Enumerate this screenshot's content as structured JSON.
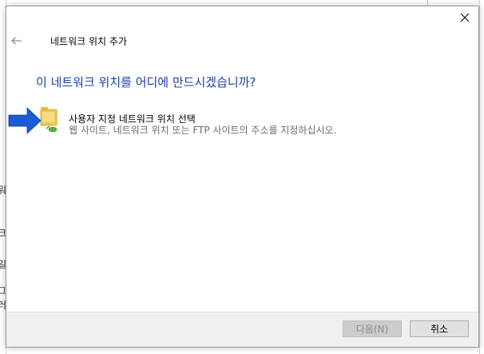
{
  "dialog": {
    "title": "네트워크 위치 추가",
    "heading": "이 네트워크 위치를 어디에 만드시겠습니까?",
    "option": {
      "title": "사용자 지정 네트워크 위치 선택",
      "description": "웹 사이트, 네트워크 위치 또는 FTP 사이트의 주소를 지정하십시오.",
      "icon": "network-folder-arrow-icon"
    },
    "buttons": {
      "next": "다음(N)",
      "cancel": "취소"
    },
    "icons": {
      "back": "back-arrow-icon",
      "close": "close-icon"
    }
  },
  "background": {
    "glyphs": [
      "워",
      "크",
      "일",
      "그",
      "러"
    ]
  },
  "colors": {
    "heading": "#1c3fa6",
    "arrow": "#1a5bd6",
    "folder": "#f0c64c",
    "footer": "#f0f0f0",
    "disabled_button": "#cccccc"
  }
}
